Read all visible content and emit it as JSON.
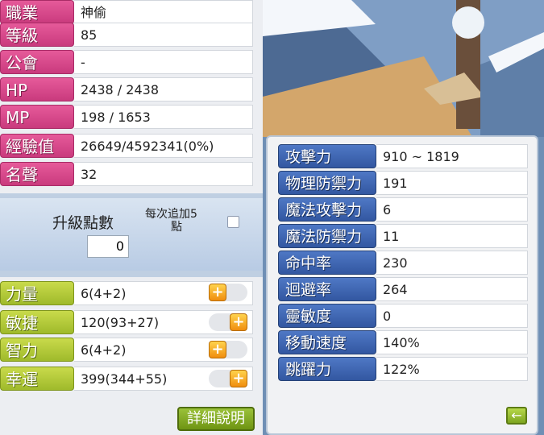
{
  "info_rows": [
    {
      "label": "職業",
      "value": "神偷"
    },
    {
      "label": "等級",
      "value": "85"
    },
    {
      "label": "公會",
      "value": "-"
    },
    {
      "label": "HP",
      "value": "2438 / 2438"
    },
    {
      "label": "MP",
      "value": "198 / 1653"
    },
    {
      "label": "經驗值",
      "value": "26649/4592341(0%)"
    },
    {
      "label": "名聲",
      "value": "32"
    }
  ],
  "points": {
    "title": "升級點數",
    "value": "0",
    "auto_add_label_line1": "每次追加5",
    "auto_add_label_line2": "點"
  },
  "ability_rows": [
    {
      "label": "力量",
      "value": "6(4+2)"
    },
    {
      "label": "敏捷",
      "value": "120(93+27)"
    },
    {
      "label": "智力",
      "value": "6(4+2)"
    },
    {
      "label": "幸運",
      "value": "399(344+55)"
    }
  ],
  "detail_button": "詳細說明",
  "right_rows": [
    {
      "label": "攻擊力",
      "value": "910 ~ 1819"
    },
    {
      "label": "物理防禦力",
      "value": "191"
    },
    {
      "label": "魔法攻擊力",
      "value": "6"
    },
    {
      "label": "魔法防禦力",
      "value": "11"
    },
    {
      "label": "命中率",
      "value": "230"
    },
    {
      "label": "迴避率",
      "value": "264"
    },
    {
      "label": "靈敏度",
      "value": "0"
    },
    {
      "label": "移動速度",
      "value": "140%"
    },
    {
      "label": "跳躍力",
      "value": "122%"
    }
  ]
}
